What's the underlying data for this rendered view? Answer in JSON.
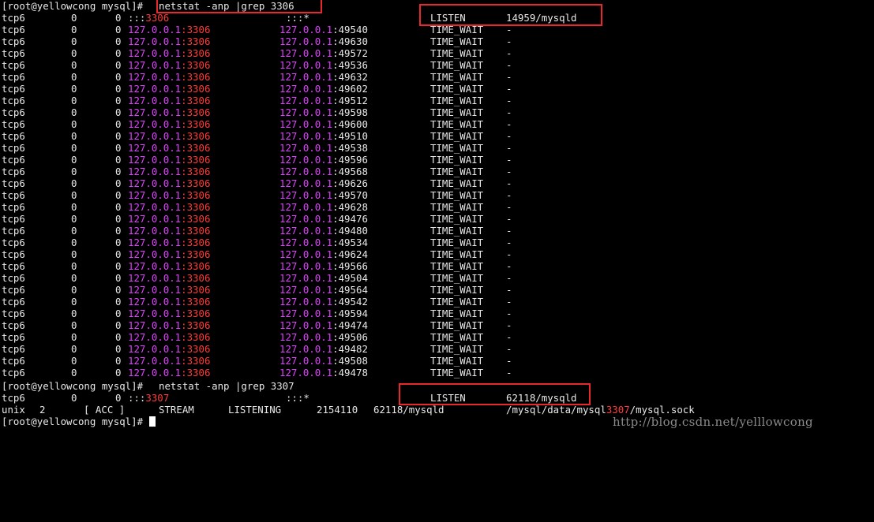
{
  "terminal": {
    "prompt": "[root@yellowcong mysql]# ",
    "command1": "netstat -anp |grep 3306",
    "listen1": {
      "proto": "tcp6",
      "recvq": "0",
      "sendq": "0",
      "local_prefix": ":::",
      "local_port": "3306",
      "foreign": ":::*",
      "state": "LISTEN",
      "program": "14959/mysqld"
    },
    "local_ip": "127.0.0.1",
    "local_sep_port": ":3306",
    "time_wait_state": "TIME_WAIT",
    "time_wait_program": "-",
    "time_wait_ports": [
      ":49540",
      ":49630",
      ":49572",
      ":49536",
      ":49632",
      ":49602",
      ":49512",
      ":49598",
      ":49600",
      ":49510",
      ":49538",
      ":49596",
      ":49568",
      ":49626",
      ":49570",
      ":49628",
      ":49476",
      ":49480",
      ":49534",
      ":49624",
      ":49566",
      ":49504",
      ":49564",
      ":49542",
      ":49594",
      ":49474",
      ":49506",
      ":49482",
      ":49508",
      ":49478"
    ],
    "command2": "netstat -anp |grep 3307",
    "listen2": {
      "proto": "tcp6",
      "recvq": "0",
      "sendq": "0",
      "local_prefix": ":::",
      "local_port": "3307",
      "foreign": ":::*",
      "state": "LISTEN",
      "program": "62118/mysqld"
    },
    "unix_line": {
      "proto": "unix",
      "refcnt": "2",
      "flags": "[ ACC ]",
      "type": "STREAM",
      "state": "LISTENING",
      "inode": "2154110",
      "program": "62118/mysqld",
      "path_prefix": "/mysql/data/mysql",
      "path_port": "3307",
      "path_suffix": "/mysql.sock"
    }
  },
  "watermark": "http://blog.csdn.net/yelllowcong",
  "colors": {
    "background": "#000000",
    "text": "#e8e8e8",
    "ip_highlight": "#e040ff",
    "port_highlight": "#ff3c3c",
    "annotation_box": "#e8282c"
  }
}
